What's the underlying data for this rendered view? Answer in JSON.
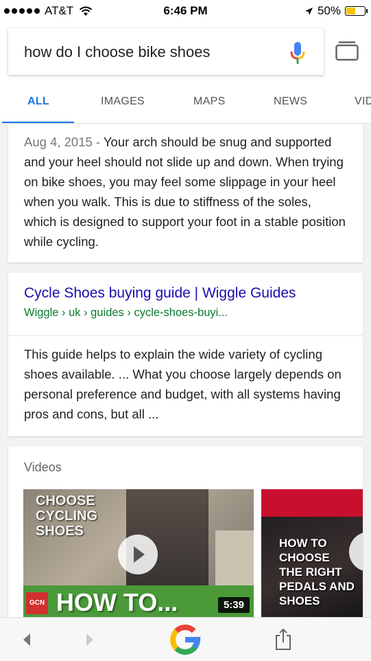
{
  "status_bar": {
    "carrier": "AT&T",
    "time": "6:46 PM",
    "battery_percent": "50%",
    "battery_level": 0.5
  },
  "search": {
    "query": "how do I choose bike shoes"
  },
  "tabs": [
    {
      "label": "ALL",
      "active": true
    },
    {
      "label": "IMAGES",
      "active": false
    },
    {
      "label": "MAPS",
      "active": false
    },
    {
      "label": "NEWS",
      "active": false
    },
    {
      "label": "VID",
      "active": false
    }
  ],
  "snippet_card": {
    "date": "Aug 4, 2015",
    "separator": " - ",
    "text": "Your arch should be snug and supported and your heel should not slide up and down. When trying on bike shoes, you may feel some slippage in your heel when you walk. This is due to stiffness of the soles, which is designed to support your foot in a stable position while cycling."
  },
  "result_card": {
    "title": "Cycle Shoes buying guide | Wiggle Guides",
    "url": "Wiggle › uk › guides › cycle-shoes-buyi...",
    "description": "This guide helps to explain the wide variety of cycling shoes available. ... What you choose largely depends on personal preference and budget, with all systems having pros and cons, but all ..."
  },
  "videos": {
    "heading": "Videos",
    "items": [
      {
        "overlay_top": "CHOOSE CYCLING SHOES",
        "overlay_bottom": "HOW TO...",
        "badge": "GCN",
        "duration": "5:39"
      },
      {
        "overlay_top": "HOW TO CHOOSE THE RIGHT PEDALS AND SHOES"
      }
    ]
  },
  "toolbar": {
    "back": "back-icon",
    "forward": "forward-icon",
    "home": "google-logo",
    "share": "share-icon"
  }
}
